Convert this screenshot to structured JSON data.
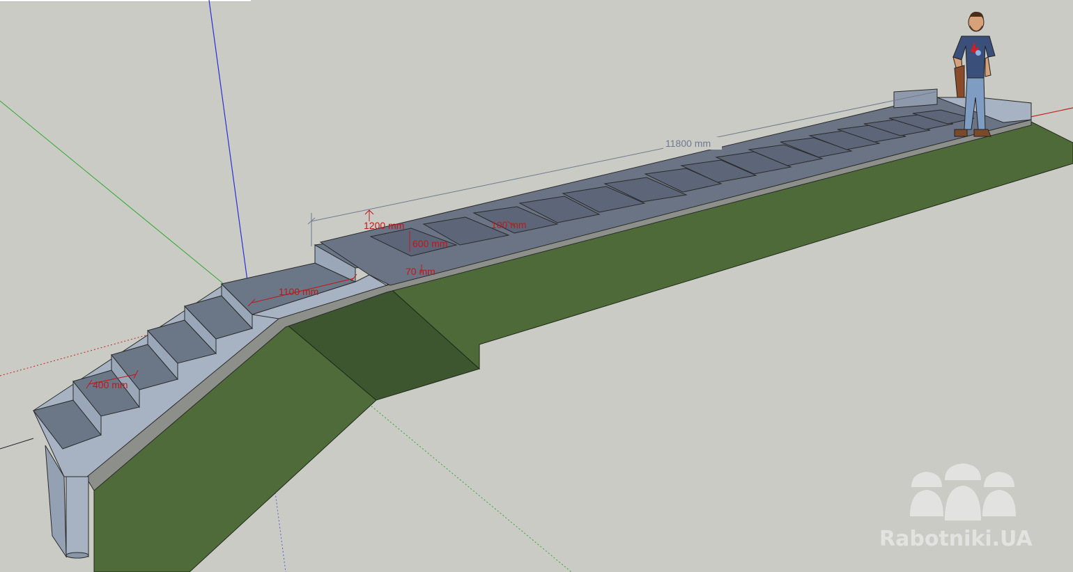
{
  "scene": {
    "dimensions": {
      "total_length": "11800 mm",
      "width_1200": "1200 mm",
      "width_600": "600 mm",
      "gap_100": "100 mm",
      "thickness_70": "70 mm",
      "landing_1100": "1100 mm",
      "step_400": "400 mm"
    },
    "colors": {
      "background": "#c9cbc4",
      "grass": "#4f6b3a",
      "grass_dark": "#3d5630",
      "concrete_top": "#6b7687",
      "concrete_side": "#a7b3c2",
      "slab_top": "#5c6678",
      "dimension_red": "#c01818",
      "dimension_grey": "#6f7a8e",
      "axis_blue": "#2d2dd8",
      "axis_green": "#2fa82f",
      "axis_red": "#c42020"
    }
  },
  "watermark": {
    "text": "Rabotniki.UA",
    "icon": "builders-helmet-icon"
  }
}
